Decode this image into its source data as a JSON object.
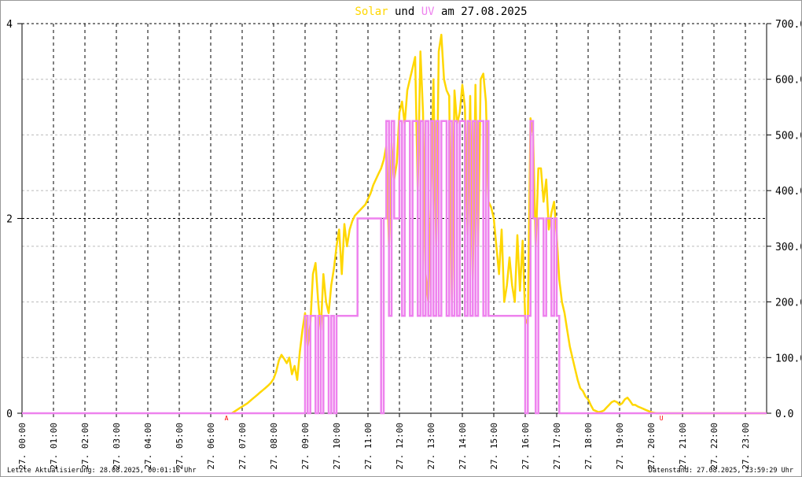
{
  "chart_data": {
    "type": "line",
    "title": {
      "parts": [
        "Solar",
        " und ",
        "UV",
        " am 27.08.2025"
      ]
    },
    "colors": {
      "solar": "#FFD700",
      "uv": "#EE82EE",
      "marker": "#FF0000"
    },
    "left_axis": {
      "ylim": [
        0,
        4
      ],
      "ticks": [
        "0",
        "2",
        "4"
      ],
      "tick_values": [
        0,
        2,
        4
      ]
    },
    "right_axis": {
      "ylim": [
        0,
        700
      ],
      "ticks": [
        "0.0",
        "100.0",
        "200.0",
        "300.0",
        "400.0",
        "500.0",
        "600.0",
        "700.0"
      ],
      "tick_values": [
        0,
        100,
        200,
        300,
        400,
        500,
        600,
        700
      ]
    },
    "x_ticks": [
      "27. 00:00",
      "27. 01:00",
      "27. 02:00",
      "27. 03:00",
      "27. 04:00",
      "27. 05:00",
      "27. 06:00",
      "27. 07:00",
      "27. 08:00",
      "27. 09:00",
      "27. 10:00",
      "27. 11:00",
      "27. 12:00",
      "27. 13:00",
      "27. 14:00",
      "27. 15:00",
      "27. 16:00",
      "27. 17:00",
      "27. 18:00",
      "27. 19:00",
      "27. 20:00",
      "27. 21:00",
      "27. 22:00",
      "27. 23:00"
    ],
    "x_range_hours": [
      0,
      23.67
    ],
    "markers": [
      {
        "label": "A",
        "hour": 6.5
      },
      {
        "label": "U",
        "hour": 20.33
      }
    ],
    "series": [
      {
        "name": "Solar",
        "axis": "right",
        "start_hour": 6.6667,
        "step_minutes": 5,
        "values": [
          0,
          3,
          6,
          9,
          12,
          15,
          18,
          22,
          26,
          30,
          34,
          38,
          42,
          46,
          50,
          55,
          62,
          75,
          95,
          105,
          98,
          90,
          100,
          70,
          85,
          60,
          110,
          150,
          180,
          120,
          160,
          250,
          270,
          200,
          150,
          250,
          200,
          180,
          230,
          260,
          300,
          330,
          250,
          340,
          300,
          330,
          345,
          355,
          360,
          365,
          370,
          375,
          385,
          395,
          410,
          420,
          430,
          440,
          455,
          480,
          300,
          485,
          420,
          450,
          540,
          560,
          520,
          580,
          600,
          620,
          640,
          400,
          650,
          540,
          250,
          200,
          380,
          600,
          300,
          650,
          680,
          600,
          580,
          570,
          200,
          580,
          520,
          540,
          590,
          550,
          320,
          570,
          240,
          590,
          300,
          600,
          610,
          560,
          380,
          370,
          350,
          300,
          250,
          330,
          200,
          230,
          280,
          230,
          200,
          320,
          220,
          310,
          170,
          160,
          530,
          500,
          300,
          440,
          440,
          380,
          420,
          330,
          360,
          380,
          320,
          240,
          200,
          180,
          150,
          120,
          100,
          80,
          60,
          45,
          40,
          30,
          25,
          15,
          6,
          4,
          2,
          3,
          5,
          10,
          15,
          20,
          22,
          20,
          15,
          18,
          25,
          28,
          22,
          15,
          15,
          12,
          10,
          8,
          6,
          4,
          2,
          1,
          0,
          0,
          0
        ]
      },
      {
        "name": "UV",
        "axis": "left",
        "start_hour": 9.0,
        "step_minutes": 5,
        "values": [
          1,
          0,
          1,
          1,
          0,
          1,
          0,
          1,
          1,
          0,
          1,
          0,
          1,
          1,
          1,
          1,
          1,
          1,
          1,
          1,
          2,
          2,
          2,
          2,
          2,
          2,
          2,
          2,
          2,
          0,
          2,
          3,
          1,
          3,
          2,
          2,
          3,
          1,
          3,
          3,
          1,
          3,
          3,
          1,
          3,
          1,
          3,
          1,
          3,
          1,
          3,
          1,
          3,
          3,
          1,
          3,
          1,
          3,
          1,
          3,
          3,
          1,
          3,
          1,
          3,
          1,
          3,
          3,
          1,
          3,
          1,
          1,
          1,
          1,
          1,
          1,
          1,
          1,
          1,
          1,
          1,
          1,
          1,
          1,
          0,
          1,
          3,
          2,
          0,
          2,
          2,
          1,
          2,
          2,
          1,
          2,
          1,
          0,
          0,
          0
        ]
      }
    ]
  },
  "footer": {
    "left": "Letzte Aktualisierung: 28.08.2025, 00:01:16 Uhr",
    "right": "Datenstand: 27.08.2025, 23:59:29 Uhr"
  }
}
